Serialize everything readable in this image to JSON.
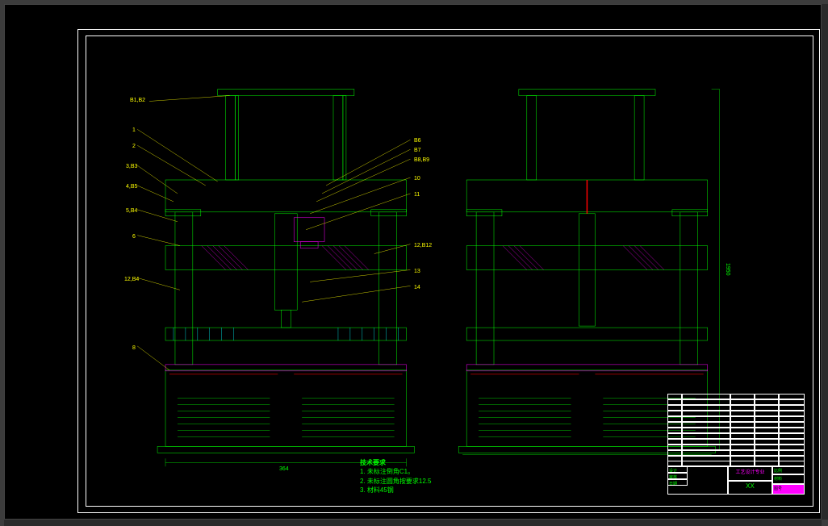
{
  "callouts": {
    "c1": "B1,B2",
    "c2": "1",
    "c3": "2",
    "c4": "3,B3",
    "c5": "4,B5",
    "c6": "5,B4",
    "c7": "6",
    "c8": "12,B4",
    "c9": "8",
    "c10": "B6",
    "c11": "B7",
    "c12": "B8,B9",
    "c13": "10",
    "c14": "11",
    "c15": "12,B12",
    "c16": "13",
    "c17": "14"
  },
  "dimensions": {
    "d1": "364",
    "d2": "1950"
  },
  "notes": {
    "title": "技术要求",
    "line1": "1. 未标注倒角C1。",
    "line2": "2. 未标注圆角按要求12.5",
    "line3": "3. 材料45钢"
  },
  "titleblock": {
    "t1": "压铸",
    "t2": "工艺设计专业",
    "t3": "XX",
    "t4": "比例",
    "t5": "材料",
    "t6": "图号",
    "t7": "设计",
    "t8": "审核",
    "t9": "日期"
  }
}
